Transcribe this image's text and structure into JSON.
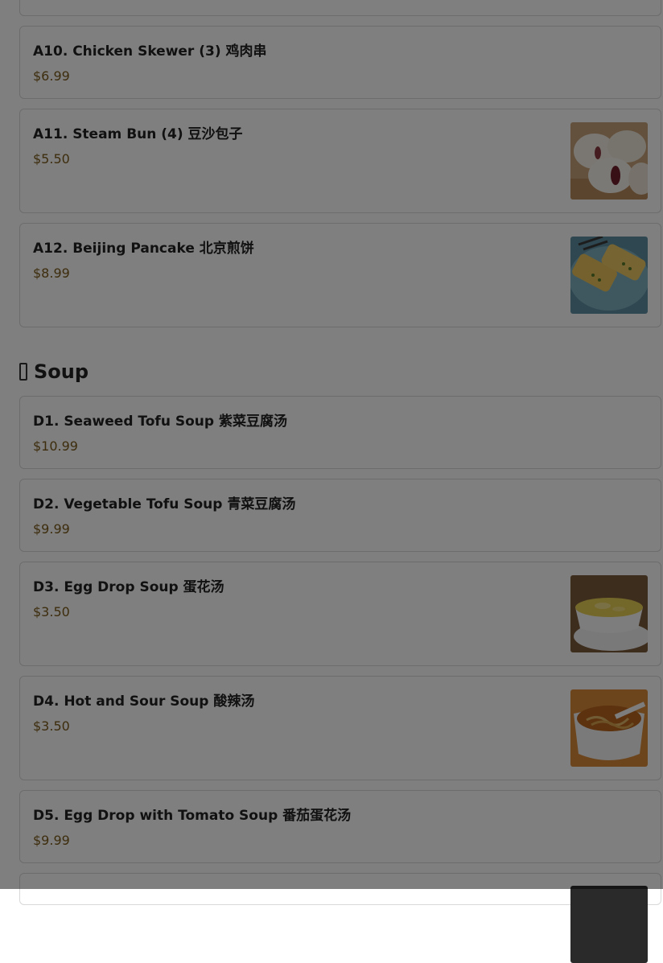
{
  "sections": {
    "soup": {
      "title": "Soup",
      "icon": "soup-section-icon"
    }
  },
  "items": {
    "a10": {
      "name": "A10. Chicken Skewer (3) 鸡肉串",
      "price": "$6.99"
    },
    "a11": {
      "name": "A11. Steam Bun (4) 豆沙包子",
      "price": "$5.50",
      "image": "steam-bun-photo"
    },
    "a12": {
      "name": "A12. Beijing Pancake 北京煎饼",
      "price": "$8.99",
      "image": "beijing-pancake-photo"
    },
    "d1": {
      "name": "D1. Seaweed Tofu Soup 紫菜豆腐汤",
      "price": "$10.99"
    },
    "d2": {
      "name": "D2. Vegetable Tofu Soup 青菜豆腐汤",
      "price": "$9.99"
    },
    "d3": {
      "name": "D3. Egg Drop Soup 蛋花汤",
      "price": "$3.50",
      "image": "egg-drop-soup-photo"
    },
    "d4": {
      "name": "D4. Hot and Sour Soup 酸辣汤",
      "price": "$3.50",
      "image": "hot-and-sour-soup-photo"
    },
    "d5": {
      "name": "D5. Egg Drop with Tomato Soup 番茄蛋花汤",
      "price": "$9.99"
    }
  },
  "colors": {
    "overlay": "rgba(0,0,0,0.5)",
    "price": "#7a5a1a",
    "card_border": "#d8d8d8"
  }
}
